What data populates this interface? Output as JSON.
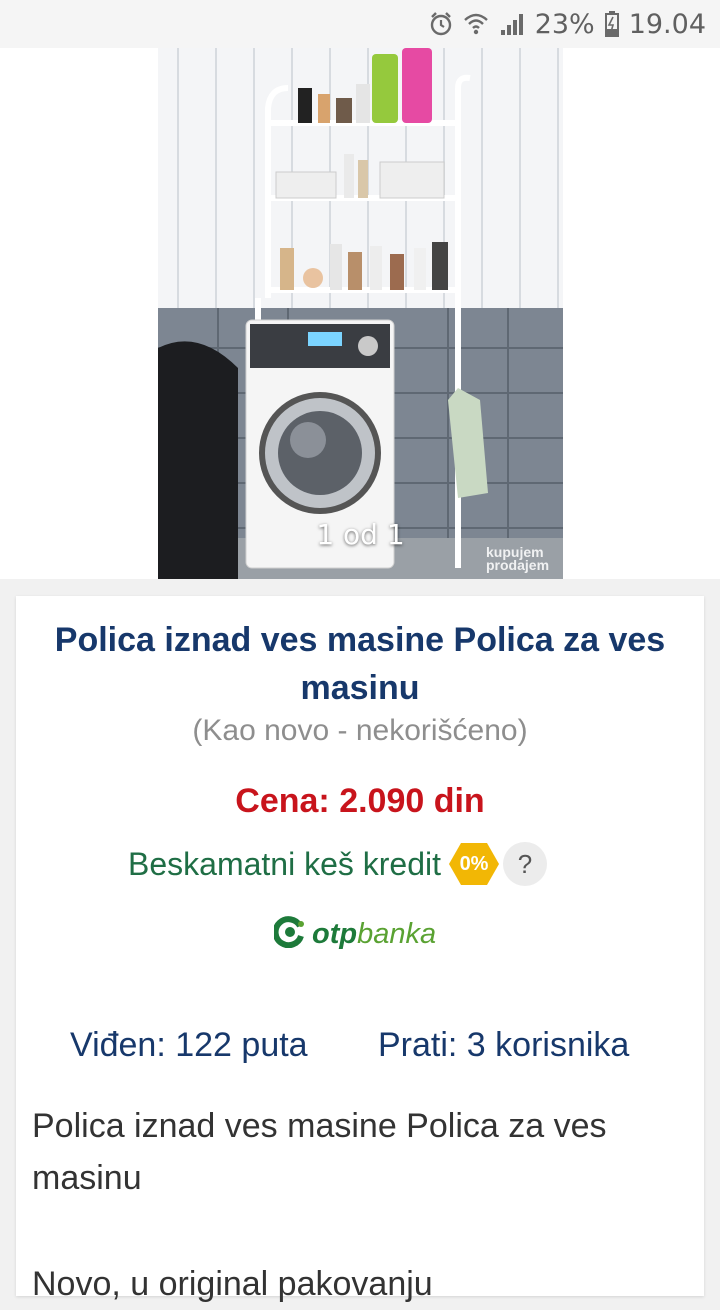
{
  "status_bar": {
    "battery": "23%",
    "time": "19.04",
    "icons": [
      "alarm-icon",
      "wifi-icon",
      "signal-icon",
      "battery-icon"
    ]
  },
  "gallery": {
    "counter": "1 od 1",
    "watermark_line1": "kupujem",
    "watermark_line2": "prodajem"
  },
  "listing": {
    "title": "Polica iznad ves masine Polica za ves masinu",
    "condition": "(Kao novo - nekorišćeno)",
    "price": "Cena: 2.090 din",
    "credit_label": "Beskamatni keš kredit",
    "credit_badge": "0%",
    "help": "?",
    "bank_part1": "otp",
    "bank_part2": "banka",
    "views": "Viđen: 122 puta",
    "followers": "Prati: 3 korisnika",
    "description": "Polica iznad ves masine Polica za ves masinu",
    "description_more": "Novo, u original pakovanju"
  },
  "colors": {
    "title": "#17386b",
    "price": "#c8141c",
    "credit": "#1f6e45",
    "badge": "#f2b705"
  }
}
